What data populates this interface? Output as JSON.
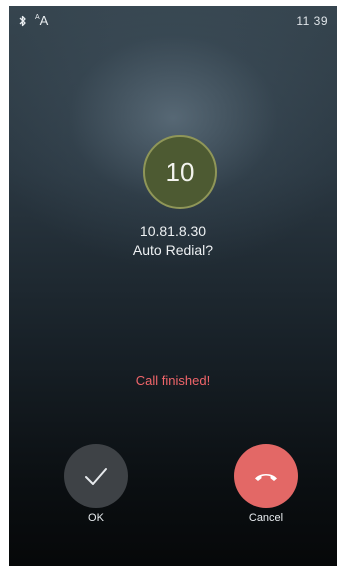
{
  "status_bar": {
    "bluetooth_icon": "bluetooth-icon",
    "font_icon_label": "A",
    "font_icon_sup": "A",
    "time": "11 39"
  },
  "call": {
    "avatar_text": "10",
    "number": "10.81.8.30",
    "prompt": "Auto Redial?",
    "status": "Call finished!"
  },
  "actions": {
    "ok_label": "OK",
    "cancel_label": "Cancel"
  },
  "colors": {
    "status_text": "#f0656a",
    "avatar_fill": "#4d5a32",
    "avatar_ring": "#8f9658",
    "ok_button": "#3e4246",
    "cancel_button": "#e36866"
  },
  "icons": {
    "ok": "checkmark-icon",
    "cancel": "hang-up-phone-icon"
  }
}
